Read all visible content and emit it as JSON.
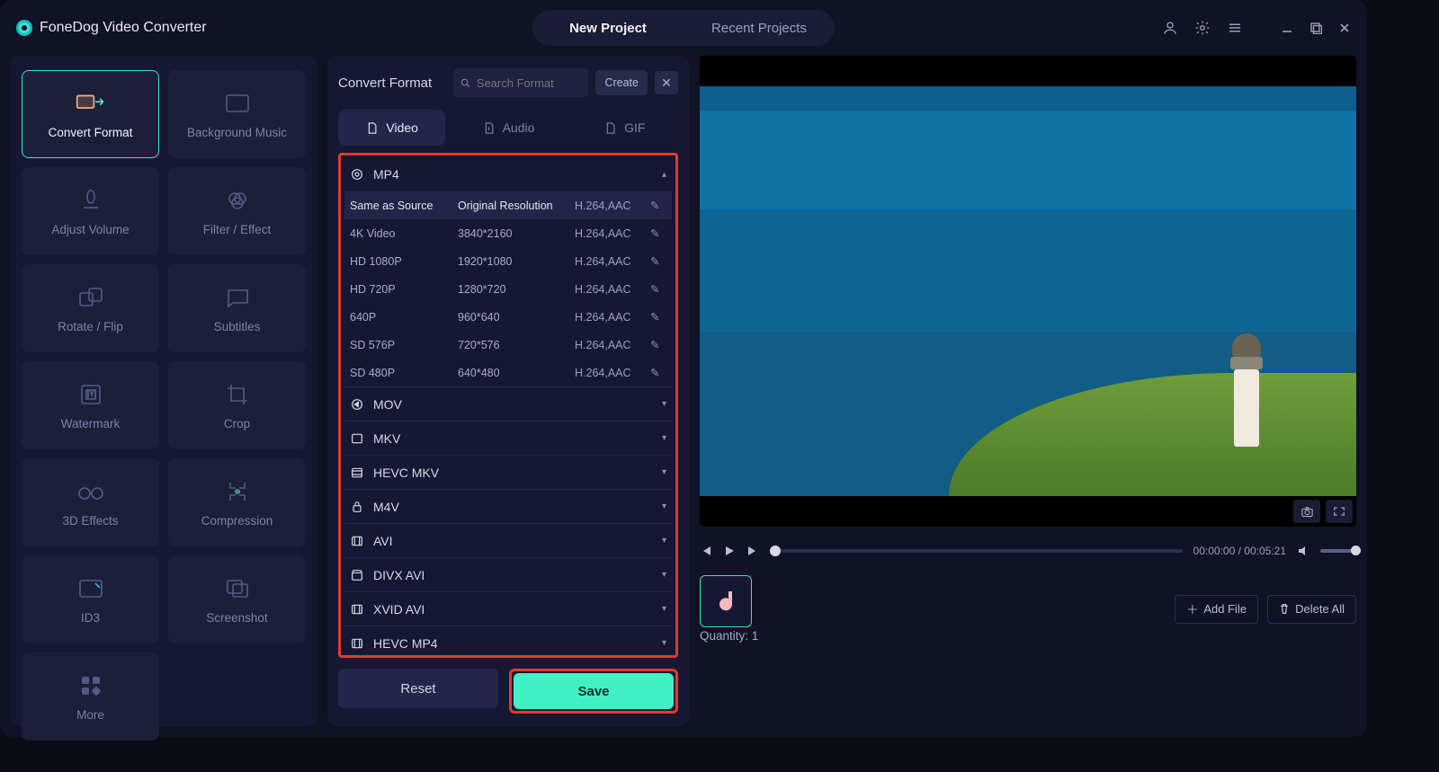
{
  "app": {
    "title": "FoneDog Video Converter"
  },
  "topTabs": {
    "new": "New Project",
    "recent": "Recent Projects"
  },
  "tools": {
    "convert": "Convert Format",
    "bgmusic": "Background Music",
    "volume": "Adjust Volume",
    "filter": "Filter / Effect",
    "rotate": "Rotate / Flip",
    "subtitles": "Subtitles",
    "watermark": "Watermark",
    "crop": "Crop",
    "fx3d": "3D Effects",
    "compress": "Compression",
    "id3": "ID3",
    "screenshot": "Screenshot",
    "more": "More"
  },
  "panel": {
    "title": "Convert Format",
    "searchPlaceholder": "Search Format",
    "create": "Create",
    "tabs": {
      "video": "Video",
      "audio": "Audio",
      "gif": "GIF"
    },
    "resetLabel": "Reset",
    "saveLabel": "Save"
  },
  "formats": {
    "mp4": "MP4",
    "mov": "MOV",
    "mkv": "MKV",
    "hevcmkv": "HEVC MKV",
    "m4v": "M4V",
    "avi": "AVI",
    "divxavi": "DIVX AVI",
    "xvidavi": "XVID AVI",
    "hevcmp4": "HEVC MP4"
  },
  "presets": {
    "p0": {
      "name": "Same as Source",
      "res": "Original Resolution",
      "codec": "H.264,AAC"
    },
    "p1": {
      "name": "4K Video",
      "res": "3840*2160",
      "codec": "H.264,AAC"
    },
    "p2": {
      "name": "HD 1080P",
      "res": "1920*1080",
      "codec": "H.264,AAC"
    },
    "p3": {
      "name": "HD 720P",
      "res": "1280*720",
      "codec": "H.264,AAC"
    },
    "p4": {
      "name": "640P",
      "res": "960*640",
      "codec": "H.264,AAC"
    },
    "p5": {
      "name": "SD 576P",
      "res": "720*576",
      "codec": "H.264,AAC"
    },
    "p6": {
      "name": "SD 480P",
      "res": "640*480",
      "codec": "H.264,AAC"
    }
  },
  "player": {
    "timeCur": "00:00:00",
    "timeSep": " / ",
    "timeTot": "00:05:21"
  },
  "filebar": {
    "addFile": "Add File",
    "deleteAll": "Delete All",
    "quantity": "Quantity: 1"
  }
}
